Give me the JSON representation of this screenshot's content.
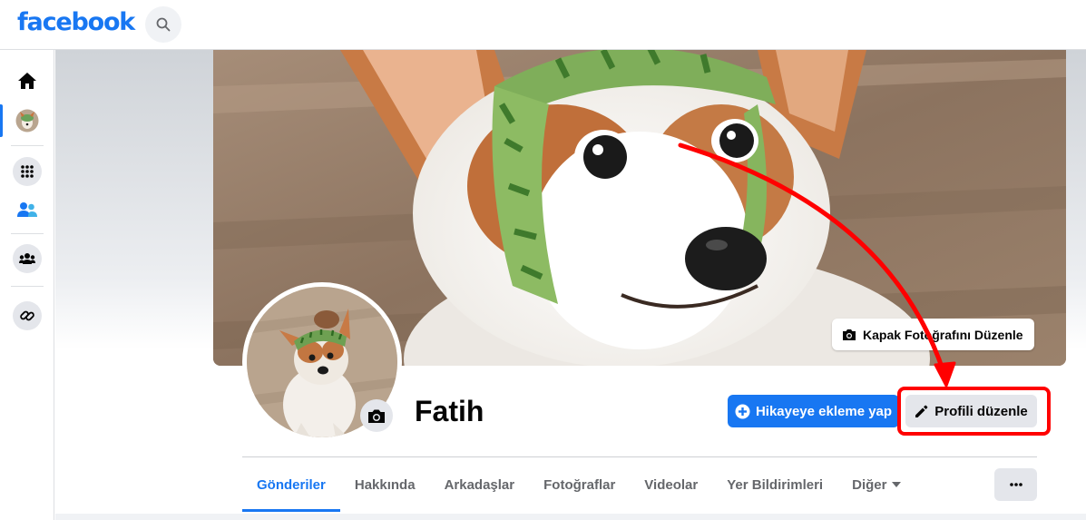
{
  "header": {
    "logo_text": "facebook",
    "search_icon": "search-icon"
  },
  "left_rail": {
    "items": [
      {
        "name": "home",
        "icon": "home-icon"
      },
      {
        "name": "profile",
        "icon": "avatar-icon",
        "active": true
      },
      {
        "name": "menu",
        "icon": "grid-menu-icon"
      },
      {
        "name": "friends",
        "icon": "friends-icon"
      },
      {
        "name": "groups",
        "icon": "groups-icon"
      },
      {
        "name": "links",
        "icon": "link-icon"
      }
    ]
  },
  "profile": {
    "name": "Fatih",
    "cover_edit_label": "Kapak Fotoğrafını Düzenle",
    "add_story_label": "Hikayeye ekleme yap",
    "edit_profile_label": "Profili düzenle"
  },
  "tabs": [
    {
      "label": "Gönderiler",
      "active": true
    },
    {
      "label": "Hakkında"
    },
    {
      "label": "Arkadaşlar"
    },
    {
      "label": "Fotoğraflar"
    },
    {
      "label": "Videolar"
    },
    {
      "label": "Yer Bildirimleri"
    },
    {
      "label": "Diğer",
      "dropdown": true
    }
  ],
  "colors": {
    "brand": "#1877f2",
    "annotation": "#ff0000",
    "button_gray": "#e4e6eb"
  }
}
